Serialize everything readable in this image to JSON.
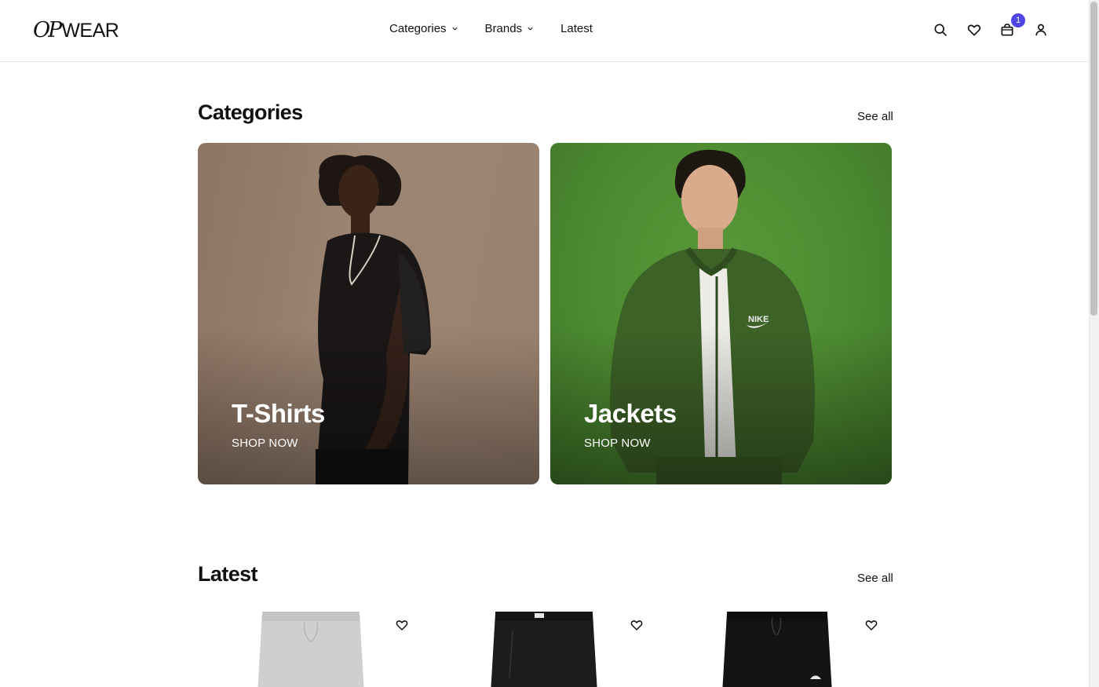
{
  "brand": {
    "logo_script": "OP",
    "logo_text": "WEAR"
  },
  "nav": {
    "categories": "Categories",
    "brands": "Brands",
    "latest": "Latest"
  },
  "header_actions": {
    "cart_count": "1",
    "icons": [
      "search-icon",
      "heart-icon",
      "bag-icon",
      "user-icon"
    ]
  },
  "categories_section": {
    "title": "Categories",
    "see_all": "See all",
    "cards": [
      {
        "title": "T-Shirts",
        "cta": "SHOP NOW",
        "bg_color": "#9a8270"
      },
      {
        "title": "Jackets",
        "cta": "SHOP NOW",
        "bg_color": "#4d8a31"
      }
    ]
  },
  "latest_section": {
    "title": "Latest",
    "see_all": "See all",
    "products": [
      {
        "color": "#cfcfcf"
      },
      {
        "color": "#1c1c1c"
      },
      {
        "color": "#141414"
      }
    ]
  },
  "colors": {
    "accent": "#4f46e5",
    "text": "#111111"
  }
}
